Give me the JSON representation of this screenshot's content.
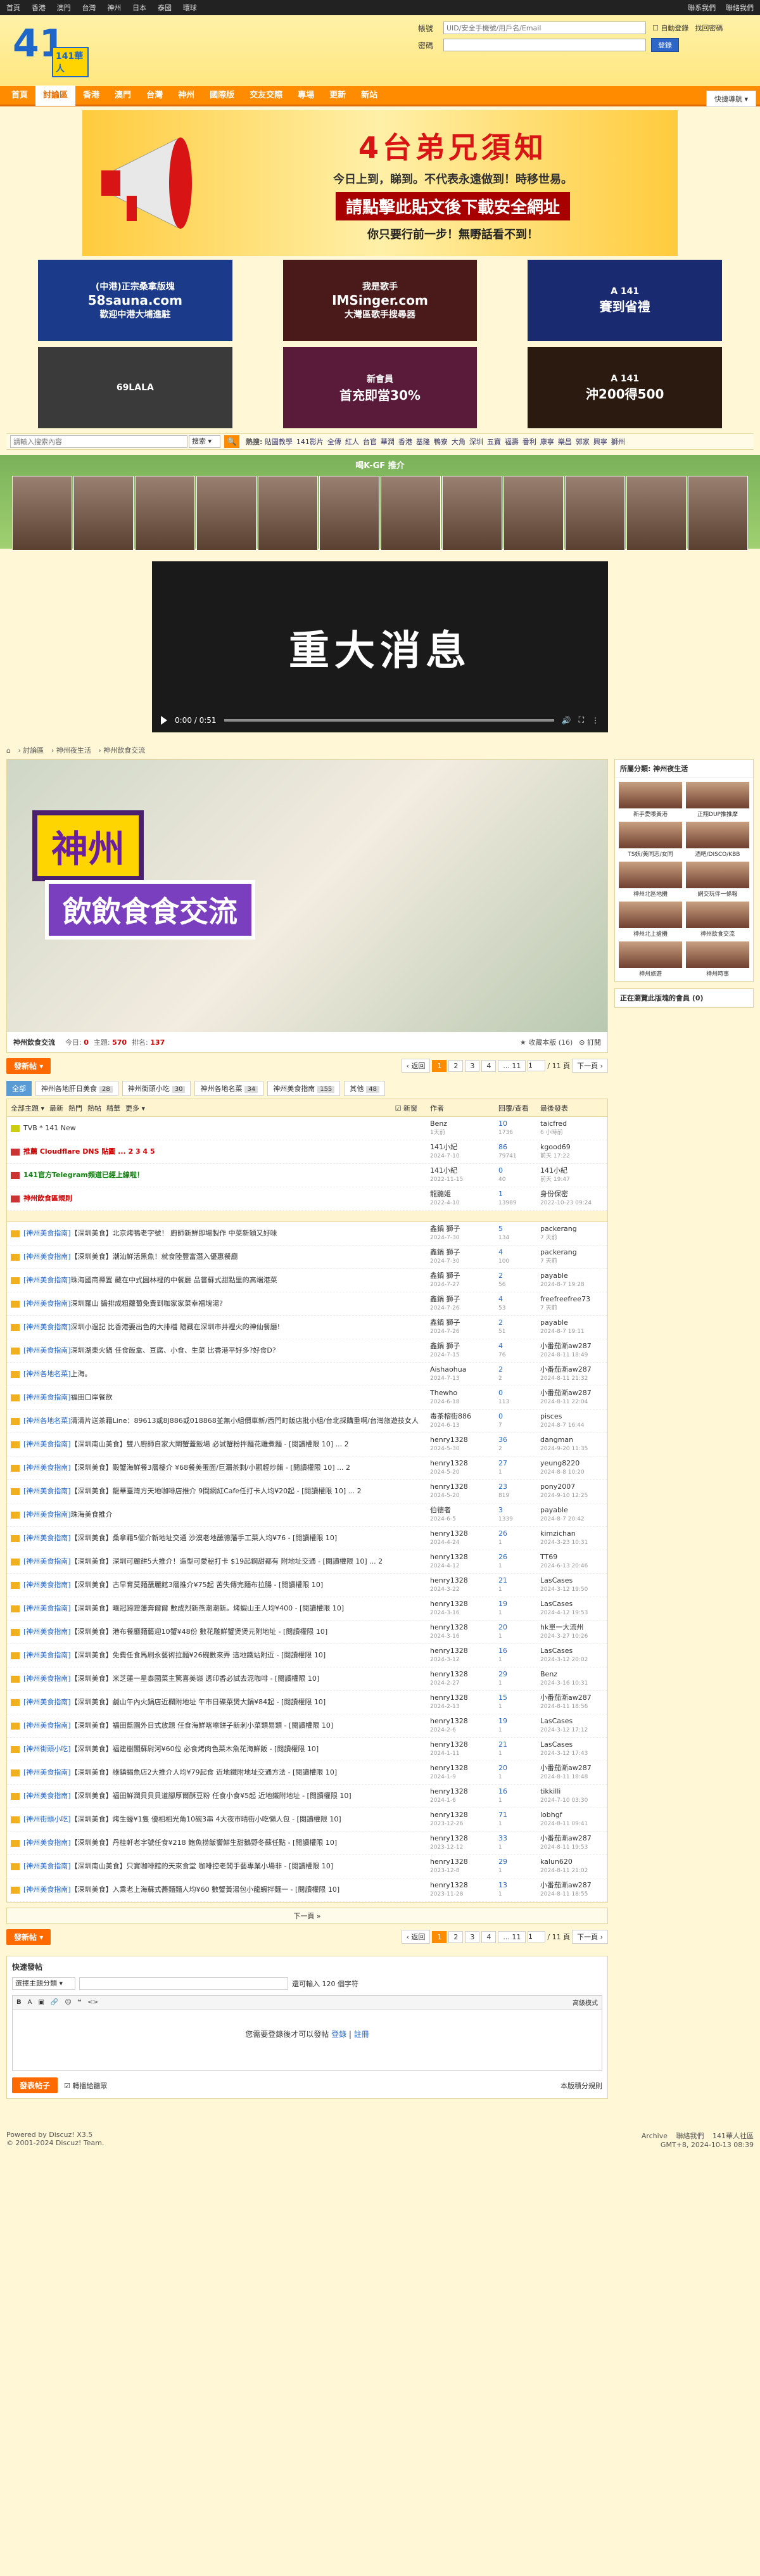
{
  "topbar": {
    "links": [
      "首頁",
      "香港",
      "澳門",
      "台灣",
      "神州",
      "日本",
      "泰國",
      "環球"
    ],
    "right": [
      "聯系我們",
      "聯絡我們"
    ]
  },
  "header": {
    "logo_big": "41",
    "logo_sub": "141華人",
    "login": {
      "account_label": "帳號",
      "account_placeholder": "UID/安全手機號/用戶名/Email",
      "auto_login": "自動登錄",
      "forgot": "找回密碼",
      "password_label": "密碼",
      "login_button": "登錄"
    }
  },
  "nav": {
    "items": [
      "首頁",
      "討論區",
      "香港",
      "澳門",
      "台灣",
      "神州",
      "國際版",
      "交友交際",
      "專場",
      "更新",
      "新站"
    ],
    "quick": "快捷導航"
  },
  "banner": {
    "t1": "4台弟兄須知",
    "t2": "今日上到，睇到。不代表永遠做到！時移世易。",
    "t3": "請點擊此貼文後下載安全網址",
    "t4": "你只要行前一步！無嘢話看不到！"
  },
  "ads": [
    {
      "line1": "(中港)正宗桑拿版塊",
      "line2": "58sauna.com",
      "line3": "歡迎中港大埔進駐",
      "bg": "#1b3a8a"
    },
    {
      "line1": "我是歌手",
      "line2": "IMSinger.com",
      "line3": "大灣區歌手搜尋器",
      "bg": "#4a1a1a"
    },
    {
      "line1": "A 141",
      "line2": "賽到省禮",
      "line3": "",
      "bg": "#1a2a70"
    },
    {
      "line1": "69LALA",
      "line2": "",
      "line3": "",
      "bg": "#3a3a3a"
    },
    {
      "line1": "新會員",
      "line2": "首充即當30%",
      "line3": "",
      "bg": "#5a1a3a"
    },
    {
      "line1": "A 141",
      "line2": "沖200得500",
      "line3": "",
      "bg": "#2a1a10"
    }
  ],
  "searchbar": {
    "placeholder": "請輸入搜索內容",
    "select": "搜索",
    "hot_label": "熱搜:",
    "hot": [
      "貼圖教學",
      "141影片",
      "全傳",
      "紅人",
      "台官",
      "華潤",
      "香港",
      "基隆",
      "鴨寮",
      "大角",
      "深圳",
      "五寶",
      "福壽",
      "番利",
      "康寧",
      "樂昌",
      "郭家",
      "興寧",
      "獅州"
    ]
  },
  "gf": {
    "title": "喝K-GF 推介"
  },
  "video": {
    "headline": "重大消息",
    "time": "0:00 / 0:51"
  },
  "breadcrumb": [
    "討論區",
    "神州夜生活",
    "神州飲食交流"
  ],
  "forum": {
    "name": "神州飲食交流",
    "today_label": "今日:",
    "today": "0",
    "topics_label": "主題:",
    "topics": "570",
    "rank_label": "排名:",
    "rank": "137",
    "favorite": "收藏本版 (16)",
    "rss": "訂閱",
    "banner1": "神州",
    "banner2": "飲飲食食交流"
  },
  "pagebar": {
    "new": "發新帖",
    "prev": "返回",
    "pages": [
      "1",
      "2",
      "3",
      "4",
      "... 11"
    ],
    "input": "1",
    "total": "/ 11 頁",
    "next": "下一頁"
  },
  "tabs": [
    {
      "label": "全部",
      "count": ""
    },
    {
      "label": "神州各地肝日美食",
      "count": "28"
    },
    {
      "label": "神州街頭小吃",
      "count": "30"
    },
    {
      "label": "神州各地名菜",
      "count": "34"
    },
    {
      "label": "神州美食指南",
      "count": "155"
    },
    {
      "label": "其他",
      "count": "48"
    }
  ],
  "thead": {
    "filters": [
      "全部主題",
      "最新",
      "熱門",
      "熱帖",
      "精華",
      "更多"
    ],
    "newwin": "新窗",
    "author": "作者",
    "replies": "回覆/查看",
    "last": "最後發表"
  },
  "threads": [
    {
      "type": "ann",
      "tag": "",
      "title": "TVB * 141 New",
      "author": "Benz",
      "adate": "1天前",
      "replies": "10",
      "views": "1736",
      "last": "taicfred",
      "ldate": "6 小時前"
    },
    {
      "type": "pin",
      "tag": "",
      "title": "推薦 Cloudflare DNS 貼圖 ... 2 3 4 5",
      "author": "141小紀",
      "adate": "2024-7-10",
      "replies": "86",
      "views": "79741",
      "last": "kgood69",
      "ldate": "前天 17:22"
    },
    {
      "type": "pin",
      "tag": "",
      "title": "141官方Telegram頻道已經上線啦！",
      "author": "141小紀",
      "adate": "2022-11-15",
      "replies": "0",
      "views": "40",
      "last": "141小紀",
      "ldate": "前天 19:47"
    },
    {
      "type": "pin",
      "tag": "",
      "title": "神州飲食區規則",
      "author": "龍聽姬",
      "adate": "2022-4-10",
      "replies": "1",
      "views": "13989",
      "last": "身份保密",
      "ldate": "2022-10-23 09:24"
    },
    {
      "type": "norm",
      "tag": "[神州美食指南]",
      "title": "【深圳美食】北京烤鴨老字號！ 廚師新鮮即場製作 中菜新穎又好味",
      "author": "鑫鍋 獅子",
      "adate": "2024-7-30",
      "replies": "5",
      "views": "134",
      "last": "packerang",
      "ldate": "7 天前"
    },
    {
      "type": "norm",
      "tag": "[神州美食指南]",
      "title": "【深圳美食】潮汕鮮活黑魚！就食陸豐富潛入優惠餐廳",
      "author": "鑫鍋 獅子",
      "adate": "2024-7-30",
      "replies": "4",
      "views": "100",
      "last": "packerang",
      "ldate": "7 天前"
    },
    {
      "type": "norm",
      "tag": "[神州美食指南]",
      "title": "珠海國商禪置 藏在中式園林裡的中餐廳 品嘗蘇式甜點里的高端港菜",
      "author": "鑫鍋 獅子",
      "adate": "2024-7-27",
      "replies": "2",
      "views": "56",
      "last": "payable",
      "ldate": "2024-8-7 19:28"
    },
    {
      "type": "norm",
      "tag": "[神州美食指南]",
      "title": "深圳羅山 醬排成粗蘿蔔免費到咖家家菜幸福塊湯?",
      "author": "鑫鍋 獅子",
      "adate": "2024-7-26",
      "replies": "4",
      "views": "53",
      "last": "freefreefree73",
      "ldate": "7 天前"
    },
    {
      "type": "norm",
      "tag": "[神州美食指南]",
      "title": "深圳小過記 比香港要出色的大排檔 隨藏在深圳市井裡火的神仙餐廳!",
      "author": "鑫鍋 獅子",
      "adate": "2024-7-26",
      "replies": "2",
      "views": "51",
      "last": "payable",
      "ldate": "2024-8-7 19:11"
    },
    {
      "type": "norm",
      "tag": "[神州美食指南]",
      "title": "深圳湖東火鍋 任食飯盒、豆腐、小食、生菜 比香港平好多?好食D?",
      "author": "鑫鍋 獅子",
      "adate": "2024-7-15",
      "replies": "4",
      "views": "76",
      "last": "小番茄漸aw287",
      "ldate": "2024-8-11 18:49"
    },
    {
      "type": "norm",
      "tag": "[神州各地名菜]",
      "title": "上海。",
      "author": "Aishaohua",
      "adate": "2024-7-13",
      "replies": "2",
      "views": "2",
      "last": "小番茄漸aw287",
      "ldate": "2024-8-11 21:32"
    },
    {
      "type": "norm",
      "tag": "[神州美食指南]",
      "title": "福田口岸餐飲",
      "author": "Thewho",
      "adate": "2024-6-18",
      "replies": "0",
      "views": "113",
      "last": "小番茄漸aw287",
      "ldate": "2024-8-11 22:04"
    },
    {
      "type": "norm",
      "tag": "[神州各地名菜]",
      "title": "清清片送茶藉Line：89613或8J886或018868並無小組價車新/西門町飯店批小組/台北採購重啊/台灣旅遊技女人",
      "author": "毒茶榕街886",
      "adate": "2024-6-13",
      "replies": "0",
      "views": "7",
      "last": "pisces",
      "ldate": "2024-8-7 16:44"
    },
    {
      "type": "norm",
      "tag": "[神州美食指南]",
      "title": "【深圳南山美食】雙八廚師自家大閘蟹蓋飯場 必試蟹粉拌麵花雕煮麵 - [閱讀權限 10] ... 2",
      "author": "henry1328",
      "adate": "2024-5-30",
      "replies": "36",
      "views": "2",
      "last": "dangman",
      "ldate": "2024-9-20 11:35"
    },
    {
      "type": "norm",
      "tag": "[神州美食指南]",
      "title": "【深圳美食】殿蟹海鮮餐3層樓介 ¥68餐美蛋面/巨漏茶剩/小觀輕炒餚 - [閱讀權限 10] ... 2",
      "author": "henry1328",
      "adate": "2024-5-20",
      "replies": "27",
      "views": "1",
      "last": "yeung8220",
      "ldate": "2024-8-8 10:20"
    },
    {
      "type": "norm",
      "tag": "[神州美食指南]",
      "title": "【深圳美食】龍華臺灣方天地咖啡店推介 9間網紅Cafe任打卡人均¥20起 - [閱讀權限 10] ... 2",
      "author": "henry1328",
      "adate": "2024-5-20",
      "replies": "23",
      "views": "819",
      "last": "pony2007",
      "ldate": "2024-9-10 12:25"
    },
    {
      "type": "norm",
      "tag": "[神州美食指南]",
      "title": "珠海美食推介",
      "author": "伯德者",
      "adate": "2024-6-5",
      "replies": "3",
      "views": "1339",
      "last": "payable",
      "ldate": "2024-8-7 20:42"
    },
    {
      "type": "norm",
      "tag": "[神州美食指南]",
      "title": "【深圳美食】桑拿藉5個介新地址交通 沙漠老地蘸德藩手工菜人均¥76 - [閱讀權限 10]",
      "author": "henry1328",
      "adate": "2024-4-24",
      "replies": "26",
      "views": "1",
      "last": "kimzichan",
      "ldate": "2024-3-23 10:31"
    },
    {
      "type": "norm",
      "tag": "[神州美食指南]",
      "title": "【深圳美食】深圳可麗餅5大推介！造型可愛秘打卡 $19起鋼甜都有 附地址交通 - [閱讀權限 10] ... 2",
      "author": "henry1328",
      "adate": "2024-4-12",
      "replies": "26",
      "views": "1",
      "last": "TT69",
      "ldate": "2024-6-13 20:46"
    },
    {
      "type": "norm",
      "tag": "[神州美食指南]",
      "title": "【深圳美食】古早育莫麵蘸麗館3層推介¥75起 苦失傳完麵布拉腸 - [閱讀權限 10]",
      "author": "henry1328",
      "adate": "2024-3-22",
      "replies": "21",
      "views": "1",
      "last": "LasCases",
      "ldate": "2024-3-12 19:50"
    },
    {
      "type": "norm",
      "tag": "[神州美食指南]",
      "title": "【深圳美食】曦冠蹄蹬藩奔爾爾 數成烈新燕潮潮新。烤蝦山王人均¥400 - [閱讀權限 10]",
      "author": "henry1328",
      "adate": "2024-3-16",
      "replies": "19",
      "views": "1",
      "last": "LasCases",
      "ldate": "2024-4-12 19:53"
    },
    {
      "type": "norm",
      "tag": "[神州美食指南]",
      "title": "【深圳美食】港布餐廳麵藝迎10蟹¥48份 數花雕鮮蟹煲煲元附地址 - [閱讀權限 10]",
      "author": "henry1328",
      "adate": "2024-3-16",
      "replies": "20",
      "views": "1",
      "last": "hk單一大流州",
      "ldate": "2024-3-27 10:26"
    },
    {
      "type": "norm",
      "tag": "[神州美食指南]",
      "title": "【深圳美食】免費任食馬刷永藝術拉麵¥26碗數來弄 這地鐵站附近 - [閱讀權限 10]",
      "author": "henry1328",
      "adate": "2024-3-12",
      "replies": "16",
      "views": "1",
      "last": "LasCases",
      "ldate": "2024-3-12 20:02"
    },
    {
      "type": "norm",
      "tag": "[神州美食指南]",
      "title": "【深圳美食】米芝蓮一星泰國菜主驚喜美嶺 透印香必試去泥咖啡 - [閱讀權限 10]",
      "author": "henry1328",
      "adate": "2024-2-27",
      "replies": "29",
      "views": "1",
      "last": "Benz",
      "ldate": "2024-3-16 10:31"
    },
    {
      "type": "norm",
      "tag": "[神州美食指南]",
      "title": "【深圳美食】鹹山午內火鍋店近欄附地址 午市日碟菜煲大鍋¥84起 - [閱讀權限 10]",
      "author": "henry1328",
      "adate": "2024-2-13",
      "replies": "15",
      "views": "1",
      "last": "小番茄漸aw287",
      "ldate": "2024-8-11 18:56"
    },
    {
      "type": "norm",
      "tag": "[神州美食指南]",
      "title": "【深圳美食】福田藍園外日式放題 任食海鮮喀嚓餅子新刺小菜類易類 - [閱讀權限 10]",
      "author": "henry1328",
      "adate": "2024-2-6",
      "replies": "19",
      "views": "1",
      "last": "LasCases",
      "ldate": "2024-3-12 17:12"
    },
    {
      "type": "norm",
      "tag": "[神州街頭小吃]",
      "title": "【深圳美食】福建樹閣蘇尉河¥60位 必食烤肉色菜木魚花海鮮飯 - [閱讀權限 10]",
      "author": "henry1328",
      "adate": "2024-1-11",
      "replies": "21",
      "views": "1",
      "last": "LasCases",
      "ldate": "2024-3-12 17:43"
    },
    {
      "type": "norm",
      "tag": "[神州美食指南]",
      "title": "【深圳美食】綠鎮蝎魚店2大推介人均¥79起食 近地鐵附地址交通方法 - [閱讀權限 10]",
      "author": "henry1328",
      "adate": "2024-1-9",
      "replies": "20",
      "views": "1",
      "last": "小番茄漸aw287",
      "ldate": "2024-8-11 18:48"
    },
    {
      "type": "norm",
      "tag": "[神州美食指南]",
      "title": "【深圳美食】福田鮮潤貝貝貝道腳厚爾酥豆粉 任食小食¥5起 近地鐵附地址 - [閱讀權限 10]",
      "author": "henry1328",
      "adate": "2024-1-6",
      "replies": "16",
      "views": "1",
      "last": "tikkilli",
      "ldate": "2024-7-10 03:30"
    },
    {
      "type": "norm",
      "tag": "[神州街頭小吃]",
      "title": "【深圳美食】烤生蠔¥1隻 優相相光角10碗3串 4大夜市晴街小吃懶人包 - [閱讀權限 10]",
      "author": "henry1328",
      "adate": "2023-12-26",
      "replies": "71",
      "views": "1",
      "last": "lobhgf",
      "ldate": "2024-8-11 09:41"
    },
    {
      "type": "norm",
      "tag": "[神州美食指南]",
      "title": "【深圳美食】丹桂軒老字號任食¥218 鮑魚捞飯饗鮮生甜鵝野冬蘇任點 - [閱讀權限 10]",
      "author": "henry1328",
      "adate": "2023-12-12",
      "replies": "33",
      "views": "1",
      "last": "小番茄漸aw287",
      "ldate": "2024-8-11 19:53"
    },
    {
      "type": "norm",
      "tag": "[神州美食指南]",
      "title": "【深圳南山美食】只實咖啡館的天來食堂 咖啡控老闆手藝專業小場非 - [閱讀權限 10]",
      "author": "henry1328",
      "adate": "2023-12-8",
      "replies": "29",
      "views": "1",
      "last": "kalun620",
      "ldate": "2024-8-11 21:02"
    },
    {
      "type": "norm",
      "tag": "[神州美食指南]",
      "title": "【深圳美食】入乘老上海蘇式蕎麵麵人均¥60 數蟹黃湯包小龍蝦拌麵一 - [閱讀權限 10]",
      "author": "henry1328",
      "adate": "2023-11-28",
      "replies": "13",
      "views": "1",
      "last": "小番茄漸aw287",
      "ldate": "2024-8-11 18:55"
    }
  ],
  "nextpage": "下一頁 »",
  "quickpost": {
    "title": "快速發帖",
    "select": "選擇主題分類",
    "limit": "還可輸入 120 個字符",
    "advanced": "高級模式",
    "msg_pre": "您需要登錄後才可以發帖",
    "login": "登錄",
    "register": "註冊",
    "submit": "發表帖子",
    "share": "轉播給聽眾",
    "rules": "本版積分規則"
  },
  "side": {
    "title": "所屬分類: 神州夜生活",
    "items": [
      "新手愛嚟黃港",
      "正翔DUP推推摩",
      "TS妖/美同志/女同",
      "酒吧/DISCO/KBB",
      "神州北區地攤",
      "網交玩伴一條報",
      "神州北上搶攤",
      "神州飲食交流",
      "神州旅遊",
      "神州時事"
    ],
    "online": "正在瀏覽此版塊的會員 (0)"
  },
  "footer": {
    "powered": "Powered by Discuz! X3.5",
    "copy": "© 2001-2024 Discuz! Team.",
    "links": [
      "Archive",
      "聯絡我們",
      "141華人社區"
    ],
    "time": "GMT+8, 2024-10-13 08:39"
  }
}
